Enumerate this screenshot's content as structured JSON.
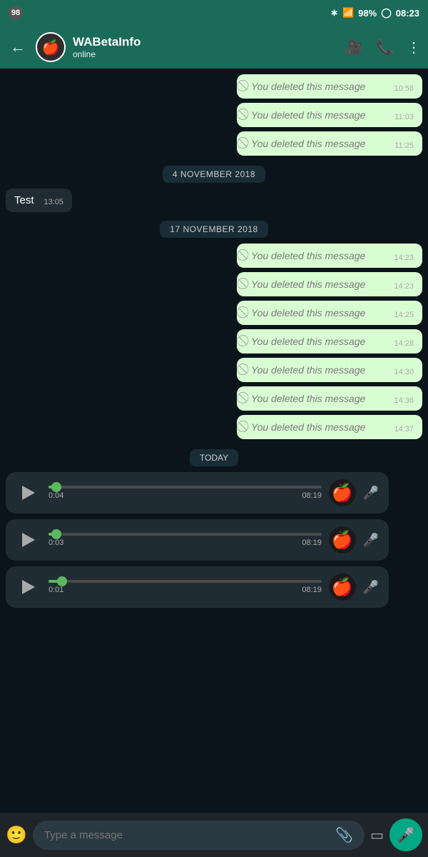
{
  "statusBar": {
    "leftIcon": "98",
    "battery": "98%",
    "time": "08:23"
  },
  "header": {
    "contactName": "WABetaInfo",
    "status": "online",
    "avatar": "🍎"
  },
  "messages": [
    {
      "type": "deleted",
      "text": "You deleted this message",
      "time": "10:58"
    },
    {
      "type": "deleted",
      "text": "You deleted this message",
      "time": "11:03"
    },
    {
      "type": "deleted",
      "text": "You deleted this message",
      "time": "11:25"
    },
    {
      "type": "date",
      "label": "4 NOVEMBER 2018"
    },
    {
      "type": "received",
      "text": "Test",
      "time": "13:05"
    },
    {
      "type": "date",
      "label": "17 NOVEMBER 2018"
    },
    {
      "type": "deleted",
      "text": "You deleted this message",
      "time": "14:23"
    },
    {
      "type": "deleted",
      "text": "You deleted this message",
      "time": "14:23"
    },
    {
      "type": "deleted",
      "text": "You deleted this message",
      "time": "14:25"
    },
    {
      "type": "deleted",
      "text": "You deleted this message",
      "time": "14:28"
    },
    {
      "type": "deleted",
      "text": "You deleted this message",
      "time": "14:30"
    },
    {
      "type": "deleted",
      "text": "You deleted this message",
      "time": "14:36"
    },
    {
      "type": "deleted",
      "text": "You deleted this message",
      "time": "14:37"
    },
    {
      "type": "today"
    },
    {
      "type": "voice",
      "duration": "0:04",
      "time": "08:19",
      "progress": 3
    },
    {
      "type": "voice",
      "duration": "0:03",
      "time": "08:19",
      "progress": 3
    },
    {
      "type": "voice",
      "duration": "0:01",
      "time": "08:19",
      "progress": 5
    }
  ],
  "inputBar": {
    "placeholder": "Type a message"
  },
  "labels": {
    "today": "TODAY",
    "deletedText": "You deleted this message"
  }
}
